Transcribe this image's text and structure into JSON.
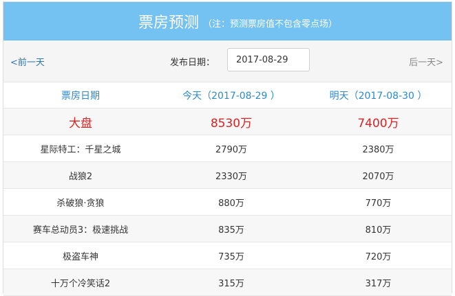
{
  "header": {
    "title": "票房预测",
    "note": "（注：预测票房值不包含零点场）"
  },
  "datebar": {
    "prev_label": "<前一天",
    "next_label": "后一天>",
    "date_label": "发布日期：",
    "date_value": "2017-08-29"
  },
  "table": {
    "headers": [
      "票房日期",
      "今天（2017-08-29 ）",
      "明天（2017-08-30 ）"
    ],
    "total": {
      "name": "大盘",
      "today": "8530万",
      "tomorrow": "7400万"
    },
    "rows": [
      {
        "name": "星际特工：千星之城",
        "today": "2790万",
        "tomorrow": "2380万"
      },
      {
        "name": "战狼2",
        "today": "2330万",
        "tomorrow": "2070万"
      },
      {
        "name": "杀破狼·贪狼",
        "today": "880万",
        "tomorrow": "770万"
      },
      {
        "name": "赛车总动员3：极速挑战",
        "today": "835万",
        "tomorrow": "810万"
      },
      {
        "name": "极盗车神",
        "today": "735万",
        "tomorrow": "720万"
      },
      {
        "name": "十万个冷笑话2",
        "today": "315万",
        "tomorrow": "317万"
      }
    ]
  },
  "colors": {
    "header_bg": "#73c2f1",
    "link": "#2b78b6",
    "total_red": "#e02020",
    "column_header_blue": "#2b8ad0"
  }
}
